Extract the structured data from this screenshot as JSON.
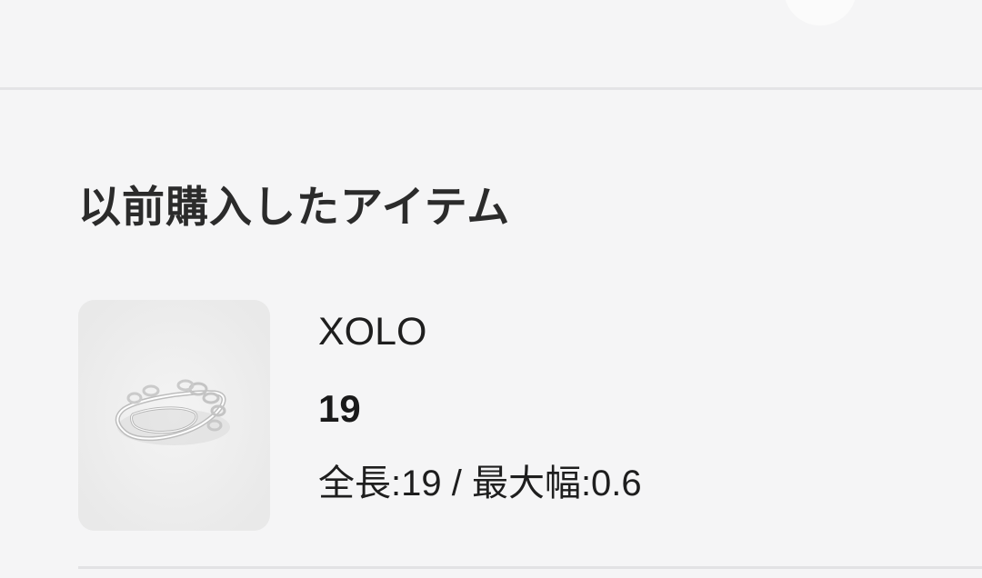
{
  "section": {
    "title": "以前購入したアイテム"
  },
  "purchased_items": [
    {
      "thumbnail_icon": "silver-chain-ring-image",
      "brand": "XOLO",
      "size": "19",
      "dimensions": "全長:19 / 最大幅:0.6"
    }
  ]
}
